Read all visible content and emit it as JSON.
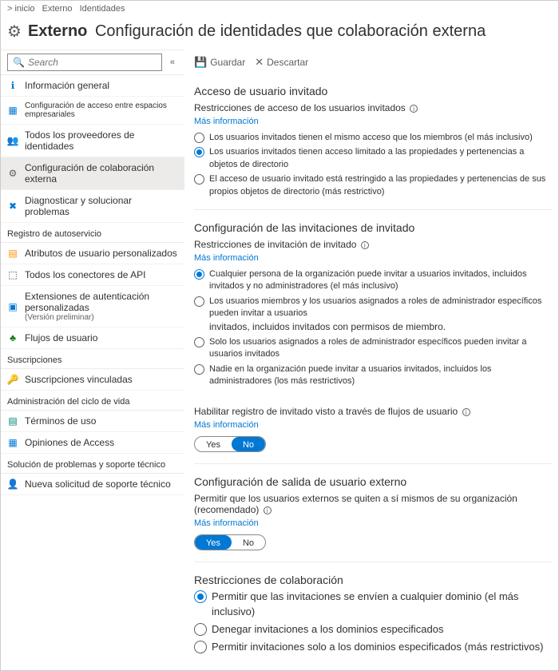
{
  "breadcrumb": {
    "a": "> inicio",
    "b": "Externo",
    "c": "Identidades"
  },
  "header": {
    "title": "Externo",
    "subtitle": "Configuración de identidades que colaboración externa"
  },
  "search": {
    "placeholder": "Search"
  },
  "nav": {
    "items0": [
      {
        "label": "Información general"
      },
      {
        "label": "Configuración de acceso entre espacios empresariales"
      },
      {
        "label": "Todos los proveedores de identidades"
      },
      {
        "label": "Configuración de colaboración externa"
      },
      {
        "label": "Diagnosticar y solucionar problemas"
      }
    ],
    "group1": "Registro de autoservicio",
    "items1": [
      {
        "label": "Atributos de usuario personalizados"
      },
      {
        "label": "Todos los conectores de API"
      },
      {
        "label": "Extensiones de autenticación personalizadas",
        "sub": "(Versión preliminar)"
      },
      {
        "label": "Flujos de usuario"
      }
    ],
    "group2": "Suscripciones",
    "items2": [
      {
        "label": "Suscripciones vinculadas"
      }
    ],
    "group3": "Administración del ciclo de vida",
    "items3": [
      {
        "label": "Términos de uso"
      },
      {
        "label": "Opiniones de Access"
      }
    ],
    "group4": "Solución de problemas y soporte técnico",
    "items4": [
      {
        "label": "Nueva solicitud de soporte técnico"
      }
    ]
  },
  "toolbar": {
    "save": "Guardar",
    "discard": "Descartar"
  },
  "sections": {
    "guestAccess": {
      "title": "Acceso de usuario invitado",
      "sub": "Restricciones de acceso de los usuarios invitados",
      "more": "Más información",
      "opt1": "Los usuarios invitados tienen el mismo acceso que los miembros (el más inclusivo)",
      "opt2": "Los usuarios invitados tienen acceso limitado a las propiedades y pertenencias a objetos de directorio",
      "opt3": "El acceso de usuario invitado está restringido a las propiedades y pertenencias de sus propios objetos de directorio (más restrictivo)"
    },
    "invite": {
      "title": "Configuración de las invitaciones de invitado",
      "sub": "Restricciones de invitación de invitado",
      "more": "Más información",
      "opt1": "Cualquier persona de la organización puede invitar a usuarios invitados, incluidos invitados y no administradores (el más inclusivo)",
      "opt2a": "Los usuarios miembros y los usuarios asignados a roles de administrador específicos pueden invitar a usuarios",
      "opt2b": "invitados, incluidos invitados con permisos de miembro.",
      "opt3": "Solo los usuarios asignados a roles de administrador específicos pueden invitar a usuarios invitados",
      "opt4": "Nadie en la organización puede invitar a usuarios invitados, incluidos los administradores (los más restrictivos)"
    },
    "selfService": {
      "title": "Habilitar registro de invitado visto a través de flujos de usuario",
      "more": "Más información",
      "yes": "Yes",
      "no": "No"
    },
    "leave": {
      "title": "Configuración de salida de usuario externo",
      "sub": "Permitir que los usuarios externos se quiten a sí mismos de su organización (recomendado)",
      "more": "Más información",
      "yes": "Yes",
      "no": "No"
    },
    "collab": {
      "title": "Restricciones de colaboración",
      "opt1": "Permitir que las invitaciones se envíen a cualquier dominio (el más inclusivo)",
      "opt2": "Denegar invitaciones a los dominios especificados",
      "opt3": "Permitir invitaciones solo a los dominios especificados (más restrictivos)"
    }
  }
}
